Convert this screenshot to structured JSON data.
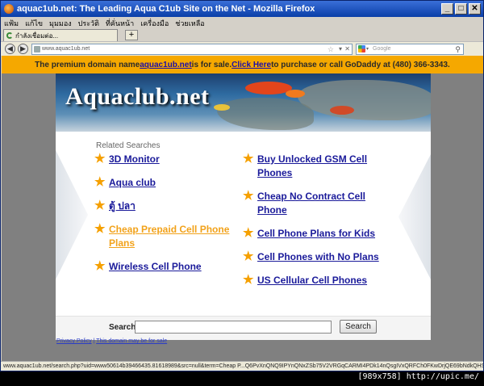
{
  "window": {
    "title": "aquac1ub.net: The Leading Aqua C1ub Site on the Net - Mozilla Firefox",
    "min": "_",
    "max": "□",
    "close": "✕"
  },
  "menu": [
    "แฟ้ม",
    "แก้ไข",
    "มุมมอง",
    "ประวัติ",
    "ที่คั่นหน้า",
    "เครื่องมือ",
    "ช่วยเหลือ"
  ],
  "tab": {
    "label": "กำลังเชื่อมต่อ...",
    "new_tab": "+"
  },
  "nav": {
    "back": "◀",
    "forward": "▶",
    "url": "www.aquac1ub.net",
    "search_placeholder": "Google",
    "star_icon": "☆",
    "dropdown_icon": "▾",
    "stop_icon": "✕",
    "magnifier_icon": "⚲"
  },
  "promo": {
    "prefix": "The premium domain name ",
    "domain": "aquac1ub.net",
    "middle": " is for sale. ",
    "cta": "Click Here",
    "suffix": " to purchase or call GoDaddy at (480) 366-3343."
  },
  "banner": {
    "logo": "Aquaclub.net"
  },
  "related": {
    "title": "Related Searches",
    "left": [
      {
        "label": "3D Monitor",
        "visited": false
      },
      {
        "label": "Aqua club",
        "visited": false
      },
      {
        "label": "ตู้ ปลา",
        "visited": false
      },
      {
        "label": "Cheap Prepaid Cell Phone Plans",
        "visited": true
      },
      {
        "label": "Wireless Cell Phone",
        "visited": false
      }
    ],
    "right": [
      {
        "label": "Buy Unlocked GSM Cell Phones",
        "visited": false
      },
      {
        "label": "Cheap No Contract Cell Phone",
        "visited": false
      },
      {
        "label": "Cell Phone Plans for Kids",
        "visited": false
      },
      {
        "label": "Cell Phones with No Plans",
        "visited": false
      },
      {
        "label": "US Cellular Cell Phones",
        "visited": false
      }
    ]
  },
  "search": {
    "label": "Search",
    "button": "Search",
    "value": ""
  },
  "footer": {
    "privacy": "Privacy Policy",
    "sep": " | ",
    "sale": "This domain may be for sale"
  },
  "status": "www.aquac1ub.net/search.php?uid=www50614b39466435.81618989&src=null&term=Cheap P...Q6PvXnQNQ9IPYnQNxZSb75V2VRGqCARMI4PDk14nQsgIVxQRFCh0FKwDrjQE69bNdkQHSkhp438LygQ",
  "watermark": "[989x758] http://upic.me/",
  "colors": {
    "promo_bg": "#f5a800",
    "link": "#1a1a9a",
    "visited": "#f2a21a",
    "star": "#f5a000"
  }
}
